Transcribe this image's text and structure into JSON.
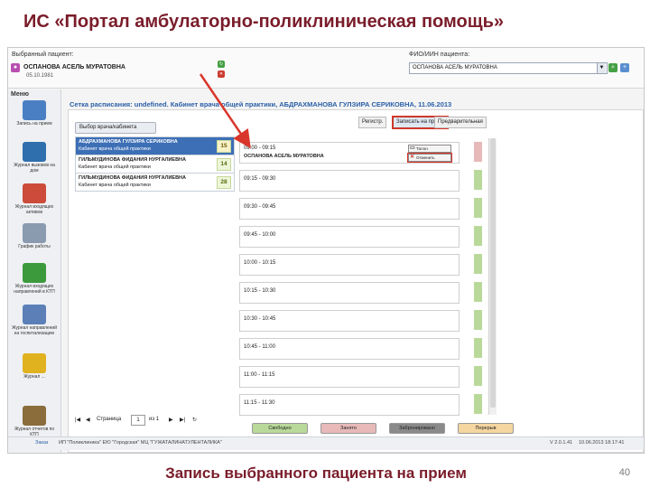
{
  "slide": {
    "title": "ИС «Портал амбулаторно-поликлиническая помощь»",
    "caption": "Запись выбранного пациента на прием",
    "page_number": "40"
  },
  "topbar": {
    "patient_label": "Выбранный пациент:",
    "patient_name": "ОСПАНОВА АСЕЛЬ МУРАТОВНА",
    "patient_dob": "05.10.1981",
    "fio_label": "ФИО/ИИН пациента:",
    "fio_value": "ОСПАНОВА АСЕЛЬ МУРАТОВНА",
    "accent_color": "#2b5fa8"
  },
  "sidebar": {
    "title": "Меню",
    "items": [
      {
        "label": "Запись на прием",
        "icon": "calendar-pen-icon",
        "color": "#4b7fc4"
      },
      {
        "label": "Журнал вызовов на дом",
        "icon": "home-call-icon",
        "color": "#2f6fad"
      },
      {
        "label": "Журнал входящих активов",
        "icon": "incoming-journal-icon",
        "color": "#cc4b3a"
      },
      {
        "label": "График работы",
        "icon": "schedule-icon",
        "color": "#8a9bb0"
      },
      {
        "label": "Журнал входящих направлений в КТП",
        "icon": "referral-arrow-icon",
        "color": "#3c9a3c"
      },
      {
        "label": "Журнал направлений на госпитализацию",
        "icon": "hospital-icon",
        "color": "#5c7fb8"
      },
      {
        "label": "Журнал ...",
        "icon": "folder-icon",
        "color": "#e0b21f"
      },
      {
        "label": "Журнал отчетов по КТП",
        "icon": "report-icon",
        "color": "#8a6d3b"
      }
    ]
  },
  "main": {
    "breadcrumb": "Сетка расписания: undefined. Кабинет врача общей практики, АБДРАХМАНОВА ГУЛЗИРА СЕРИКОВНА, 11.06.2013",
    "doctors_button": "Выбор врача/кабинета",
    "tabs": [
      "Регистр.",
      "Записать на прием",
      "Предварительная"
    ],
    "doctors": [
      {
        "name": "АБДРАХМАНОВА ГУЛЗИРА СЕРИКОВНА",
        "room": "Кабинет врача общей практики",
        "count": "15",
        "selected": true
      },
      {
        "name": "ГИЛЬМУДИНОВА ФИДАНИЯ НУРГАЛИЕВНА",
        "room": "Кабинет врача общей практики",
        "count": "14",
        "selected": false
      },
      {
        "name": "ГИЛЬМУДИНОВА ФИДАНИЯ НУРГАЛИЕВНА",
        "room": "Кабинет врача общей практики",
        "count": "28",
        "selected": false
      }
    ],
    "pager": {
      "page_label": "Страница",
      "page_value": "1",
      "of_label": "из 1"
    },
    "slots": [
      {
        "time": "09:00 - 09:15",
        "patient": "ОСПАНОВА АСЕЛЬ МУРАТОВНА",
        "booked": true,
        "stripe": "#e8b9b9"
      },
      {
        "time": "09:15 - 09:30",
        "patient": "",
        "booked": false,
        "stripe": "#b9d99a"
      },
      {
        "time": "09:30 - 09:45",
        "patient": "",
        "booked": false,
        "stripe": "#b9d99a"
      },
      {
        "time": "09:45 - 10:00",
        "patient": "",
        "booked": false,
        "stripe": "#b9d99a"
      },
      {
        "time": "10:00 - 10:15",
        "patient": "",
        "booked": false,
        "stripe": "#b9d99a"
      },
      {
        "time": "10:15 - 10:30",
        "patient": "",
        "booked": false,
        "stripe": "#b9d99a"
      },
      {
        "time": "10:30 - 10:45",
        "patient": "",
        "booked": false,
        "stripe": "#b9d99a"
      },
      {
        "time": "10:45 - 11:00",
        "patient": "",
        "booked": false,
        "stripe": "#b9d99a"
      },
      {
        "time": "11:00 - 11:15",
        "patient": "",
        "booked": false,
        "stripe": "#b9d99a"
      },
      {
        "time": "11:15 - 11:30",
        "patient": "",
        "booked": false,
        "stripe": "#b9d99a"
      }
    ],
    "slot_actions": {
      "talon": "Талон",
      "cancel": "Отменить"
    },
    "legend": [
      {
        "label": "Свободно",
        "color": "#b9d99a"
      },
      {
        "label": "Занято",
        "color": "#e8b9b9"
      },
      {
        "label": "Забронировано",
        "color": "#8a8a8a"
      },
      {
        "label": "Перерыв",
        "color": "#f5d6a0"
      }
    ]
  },
  "status_bar": {
    "left": "Заказ",
    "middle": "ИП \"Поликлиника\" ЕЮ \"Городская\" МЦ \"ГУЖАТАЛИНАТУЛЕНТАЛИКА\"",
    "version": "V 2.0.1.41",
    "datetime": "10.06.2013 18:17:41"
  }
}
